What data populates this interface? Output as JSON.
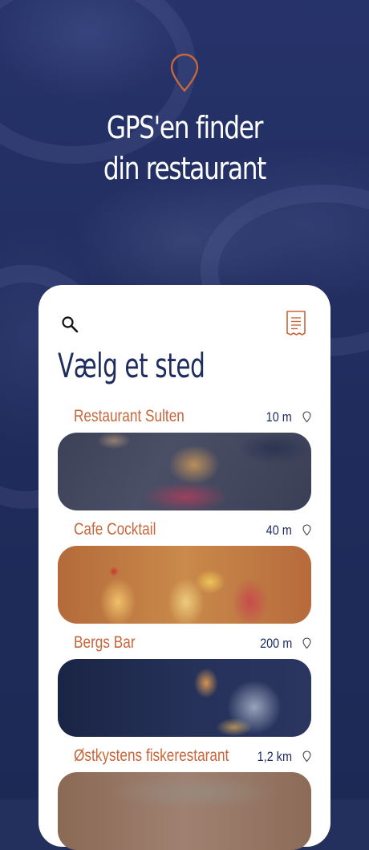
{
  "hero": {
    "title_line1": "GPS'en finder",
    "title_line2": "din restaurant",
    "icon": "location-pin-icon"
  },
  "card": {
    "search_icon": "search-icon",
    "receipt_icon": "receipt-icon",
    "title": "Vælg et sted",
    "places": [
      {
        "name": "Restaurant Sulten",
        "distance": "10 m"
      },
      {
        "name": "Cafe Cocktail",
        "distance": "40 m"
      },
      {
        "name": "Bergs Bar",
        "distance": "200 m"
      },
      {
        "name": "Østkystens fiskerestarant",
        "distance": "1,2 km"
      }
    ]
  },
  "colors": {
    "background": "#23305e",
    "accent": "#c7663b",
    "navy": "#1e2c60",
    "card": "#ffffff"
  }
}
